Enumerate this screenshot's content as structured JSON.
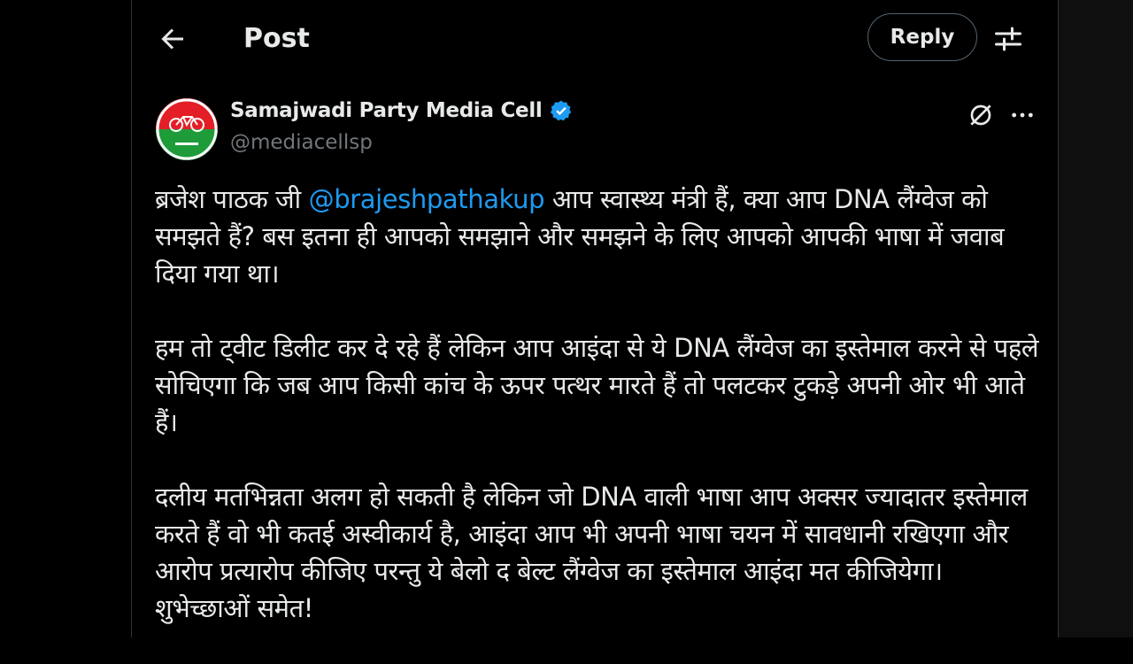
{
  "header": {
    "title": "Post",
    "reply_label": "Reply"
  },
  "icons": {
    "back": "arrow-left-icon",
    "tune": "sliders-icon",
    "verified": "verified-badge-icon",
    "grok": "grok-icon",
    "more": "more-horizontal-icon"
  },
  "colors": {
    "background": "#000000",
    "text": "#e7e9ea",
    "muted": "#71767b",
    "accent": "#1d9bf0",
    "border": "#2f3336"
  },
  "author": {
    "name": "Samajwadi Party Media Cell",
    "handle": "@mediacellsp"
  },
  "post": {
    "p1_before": "ब्रजेश पाठक जी ",
    "p1_mention": "@brajeshpathakup",
    "p1_after": " आप स्वास्थ्य मंत्री हैं, क्या आप DNA लैंग्वेज को समझते हैं? बस इतना ही आपको समझाने और समझने के लिए आपको आपकी भाषा में जवाब दिया गया था।",
    "p2": "हम तो ट्वीट डिलीट कर दे रहे हैं लेकिन आप आइंदा से ये DNA लैंग्वेज का इस्तेमाल करने से पहले सोचिएगा कि जब आप किसी कांच के ऊपर पत्थर मारते हैं तो पलटकर टुकड़े अपनी ओर भी आते हैं।",
    "p3": "दलीय मतभिन्नता अलग हो सकती है लेकिन जो DNA वाली भाषा आप अक्सर ज्यादातर इस्तेमाल करते हैं वो भी कतई अस्वीकार्य है, आइंदा आप भी अपनी भाषा चयन में सावधानी रखिएगा और आरोप प्रत्यारोप कीजिए परन्तु ये बेलो द बेल्ट लैंग्वेज का इस्तेमाल आइंदा मत कीजियेगा। शुभेच्छाओं समेत!"
  }
}
